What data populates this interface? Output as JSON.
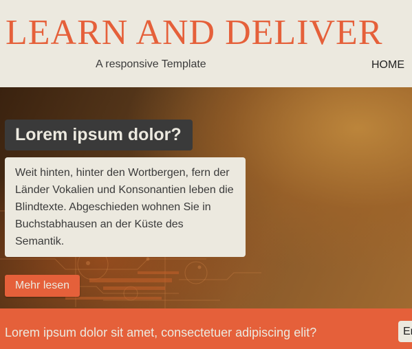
{
  "header": {
    "site_title": "LEARN AND DELIVER",
    "tagline": "A responsive Template",
    "nav": {
      "home_label": "HOME"
    }
  },
  "hero": {
    "heading": "Lorem ipsum dolor?",
    "body": "Weit hinten, hinter den Wortbergen, fern der Länder Vokalien und Konsonantien leben die Blindtexte. Abgeschieden wohnen Sie in Buchstabhausen an der Küste des Semantik.",
    "button_label": "Mehr lesen"
  },
  "cta_bar": {
    "text": "Lorem ipsum dolor sit amet, consectetuer adipiscing elit?",
    "button_label": "En"
  },
  "colors": {
    "accent": "#e5603a",
    "background": "#ece9df",
    "dark": "#3a3a3a"
  }
}
